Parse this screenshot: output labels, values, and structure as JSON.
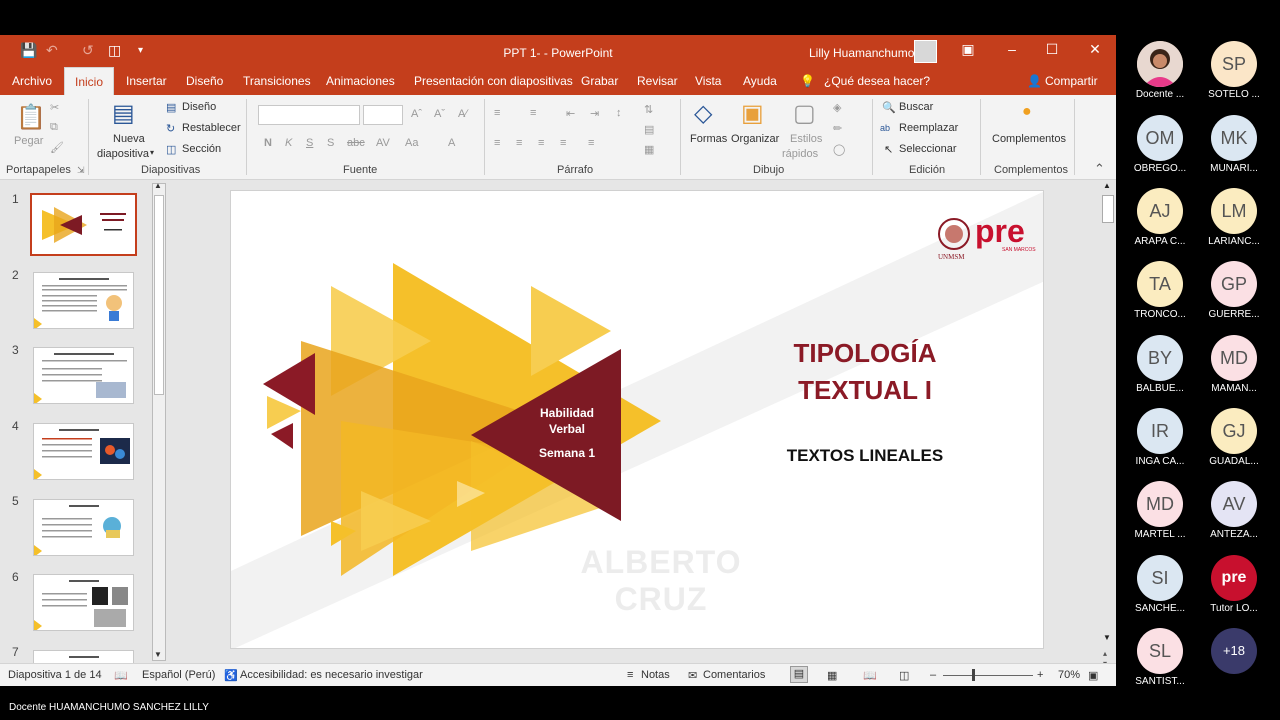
{
  "window": {
    "title": "PPT 1-  -  PowerPoint",
    "user": "Lilly Huamanchumo"
  },
  "tabs": [
    "Archivo",
    "Inicio",
    "Insertar",
    "Diseño",
    "Transiciones",
    "Animaciones",
    "Presentación con diapositivas",
    "Grabar",
    "Revisar",
    "Vista",
    "Ayuda"
  ],
  "tell_me": "¿Qué desea hacer?",
  "share": "Compartir",
  "ribbon": {
    "paste": "Pegar",
    "new_slide_1": "Nueva",
    "new_slide_2": "diapositiva",
    "layout": "Diseño",
    "reset": "Restablecer",
    "section": "Sección",
    "shapes": "Formas",
    "arrange": "Organizar",
    "styles_1": "Estilos",
    "styles_2": "rápidos",
    "find": "Buscar",
    "replace": "Reemplazar",
    "select": "Seleccionar",
    "addins": "Complementos",
    "groups": {
      "clipboard": "Portapapeles",
      "slides": "Diapositivas",
      "font": "Fuente",
      "paragraph": "Párrafo",
      "drawing": "Dibujo",
      "editing": "Edición",
      "addins": "Complementos"
    }
  },
  "thumb_numbers": [
    "1",
    "2",
    "3",
    "4",
    "5",
    "6",
    "7"
  ],
  "slide": {
    "logo_text": "pre",
    "logo_sub": "SAN MARCOS",
    "logo_uni": "UNMSM",
    "title_1": "TIPOLOGÍA",
    "title_2": "TEXTUAL I",
    "subtitle": "TEXTOS LINEALES",
    "banner_1": "Habilidad",
    "banner_2": "Verbal",
    "banner_3": "Semana 1",
    "watermark": "ALBERTO CRUZ"
  },
  "status": {
    "slide_info": "Diapositiva 1 de 14",
    "language": "Español (Perú)",
    "accessibility": "Accesibilidad: es necesario investigar",
    "notes": "Notas",
    "comments": "Comentarios",
    "zoom": "70%"
  },
  "participants": [
    {
      "initials": "",
      "name": "Docente ..."
    },
    {
      "initials": "SP",
      "name": "SOTELO ..."
    },
    {
      "initials": "OM",
      "name": "OBREGO..."
    },
    {
      "initials": "MK",
      "name": "MUNARI..."
    },
    {
      "initials": "AJ",
      "name": "ARAPA C..."
    },
    {
      "initials": "LM",
      "name": "LARIANC..."
    },
    {
      "initials": "TA",
      "name": "TRONCO..."
    },
    {
      "initials": "GP",
      "name": "GUERRE..."
    },
    {
      "initials": "BY",
      "name": "BALBUE..."
    },
    {
      "initials": "MD",
      "name": "MAMAN..."
    },
    {
      "initials": "IR",
      "name": "INGA CA..."
    },
    {
      "initials": "GJ",
      "name": "GUADAL..."
    },
    {
      "initials": "MD",
      "name": "MARTEL ..."
    },
    {
      "initials": "AV",
      "name": "ANTEZA..."
    },
    {
      "initials": "SI",
      "name": "SANCHE..."
    },
    {
      "initials": "",
      "name": "Tutor LO..."
    },
    {
      "initials": "SL",
      "name": "SANTIST..."
    },
    {
      "initials": "+18",
      "name": ""
    }
  ],
  "footer": "Docente HUAMANCHUMO SANCHEZ LILLY"
}
